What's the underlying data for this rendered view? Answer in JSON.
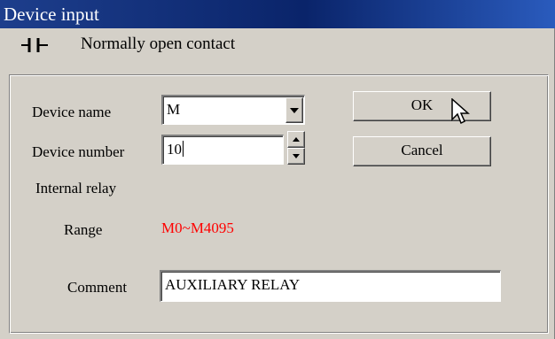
{
  "window": {
    "title": "Device input"
  },
  "instruction": {
    "icon": "contact-icon",
    "label": "Normally open contact"
  },
  "form": {
    "device_name_label": "Device name",
    "device_name_value": "M",
    "device_number_label": "Device number",
    "device_number_value": "10",
    "device_type": "Internal relay",
    "range_label": "Range",
    "range_value": "M0~M4095",
    "comment_label": "Comment",
    "comment_value": "AUXILIARY RELAY"
  },
  "buttons": {
    "ok": "OK",
    "cancel": "Cancel"
  },
  "colors": {
    "title_bar": "#0a246a",
    "range_text": "#ff0000",
    "dialog_bg": "#d4d0c8"
  }
}
